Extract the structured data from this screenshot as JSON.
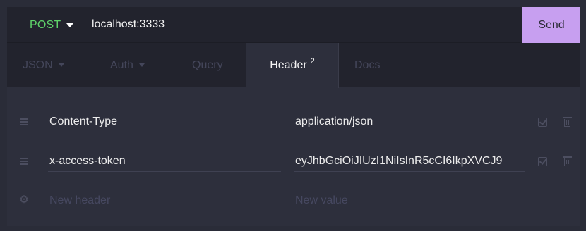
{
  "colors": {
    "background": "#2d2f3c",
    "topbar": "#22232d",
    "method_green": "#5fd36a",
    "send_purple": "#c79ff0",
    "muted": "#44465a"
  },
  "urlbar": {
    "method": "POST",
    "url": "localhost:3333",
    "send_label": "Send"
  },
  "tabs": [
    {
      "label": "JSON",
      "has_dropdown": true,
      "active": false
    },
    {
      "label": "Auth",
      "has_dropdown": true,
      "active": false
    },
    {
      "label": "Query",
      "has_dropdown": false,
      "active": false
    },
    {
      "label": "Header",
      "badge": "2",
      "has_dropdown": false,
      "active": true
    },
    {
      "label": "Docs",
      "has_dropdown": false,
      "active": false
    }
  ],
  "headers": [
    {
      "name": "Content-Type",
      "value": "application/json",
      "enabled": true
    },
    {
      "name": "x-access-token",
      "value": "eyJhbGciOiJIUzI1NiIsInR5cCI6IkpXVCJ9",
      "enabled": true
    }
  ],
  "new_row": {
    "name_placeholder": "New header",
    "value_placeholder": "New value"
  },
  "icons": {
    "method_dropdown": "caret-down-icon",
    "drag": "drag-handle-icon",
    "new_row": "gear-icon",
    "enabled": "checkbox-icon",
    "delete": "trash-icon"
  }
}
